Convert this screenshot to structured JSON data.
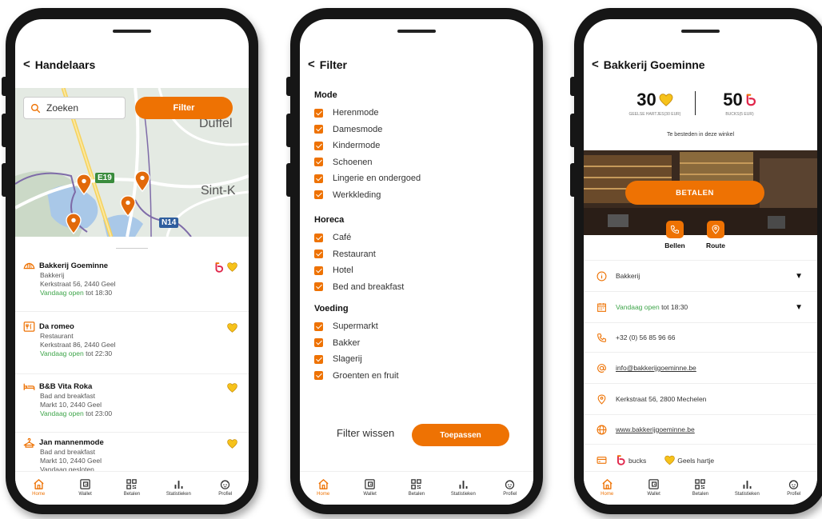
{
  "colors": {
    "accent": "#ee7203",
    "open": "#3ea54a"
  },
  "tabbar": [
    "Home",
    "Wallet",
    "Betalen",
    "Statistieken",
    "Profiel"
  ],
  "screen1": {
    "title": "Handelaars",
    "search_placeholder": "Zoeken",
    "filter_button": "Filter",
    "map_labels": {
      "road1": "E19",
      "road2": "N14",
      "town1": "Duffel",
      "town2": "Sint-K"
    },
    "merchants": [
      {
        "name": "Bakkerij Goeminne",
        "category": "Bakkerij",
        "address": "Kerkstraat 56, 2440 Geel",
        "status": "Vandaag open",
        "hours": "tot 18:30",
        "icon": "croissant-icon",
        "bucks": true,
        "hearts": true
      },
      {
        "name": "Da romeo",
        "category": "Restaurant",
        "address": "Kerkstraat 86, 2440 Geel",
        "status": "Vandaag open",
        "hours": "tot 22:30",
        "icon": "cutlery-icon",
        "bucks": false,
        "hearts": true
      },
      {
        "name": "B&B Vita Roka",
        "category": "Bad and breakfast",
        "address": "Markt 10, 2440 Geel",
        "status": "Vandaag open",
        "hours": "tot 23:00",
        "icon": "bed-icon",
        "bucks": false,
        "hearts": true
      },
      {
        "name": "Jan mannenmode",
        "category": "Bad and breakfast",
        "address": "Markt 10, 2440 Geel",
        "status": "Vandaag gesloten",
        "hours": "",
        "icon": "hanger-icon",
        "bucks": false,
        "hearts": true
      }
    ]
  },
  "screen2": {
    "title": "Filter",
    "sections": [
      {
        "title": "Mode",
        "items": [
          "Herenmode",
          "Damesmode",
          "Kindermode",
          "Schoenen",
          "Lingerie en ondergoed",
          "Werkkleding"
        ]
      },
      {
        "title": "Horeca",
        "items": [
          "Café",
          "Restaurant",
          "Hotel",
          "Bed and breakfast"
        ]
      },
      {
        "title": "Voeding",
        "items": [
          "Supermarkt",
          "Bakker",
          "Slagerij",
          "Groenten en fruit"
        ]
      }
    ],
    "clear_label": "Filter wissen",
    "apply_label": "Toepassen"
  },
  "screen3": {
    "title": "Bakkerij Goeminne",
    "hearts_amount": "30",
    "hearts_label": "GEELSE HARTJES(30 EUR)",
    "bucks_amount": "50",
    "bucks_label": "BUCKS(5 EUR)",
    "spend_label": "Te besteden in deze winkel",
    "pay_button": "BETALEN",
    "call_label": "Bellen",
    "route_label": "Route",
    "category": "Bakkerij",
    "status": "Vandaag open",
    "hours": "tot 18:30",
    "phone": "+32 (0) 56 85 96 66",
    "email": "info@bakkerijgoeminne.be",
    "address": "Kerkstraat 56, 2800 Mechelen",
    "website": "www.bakkerijgoeminne.be",
    "payment_bucks": "bucks",
    "payment_hearts": "Geels hartje"
  }
}
